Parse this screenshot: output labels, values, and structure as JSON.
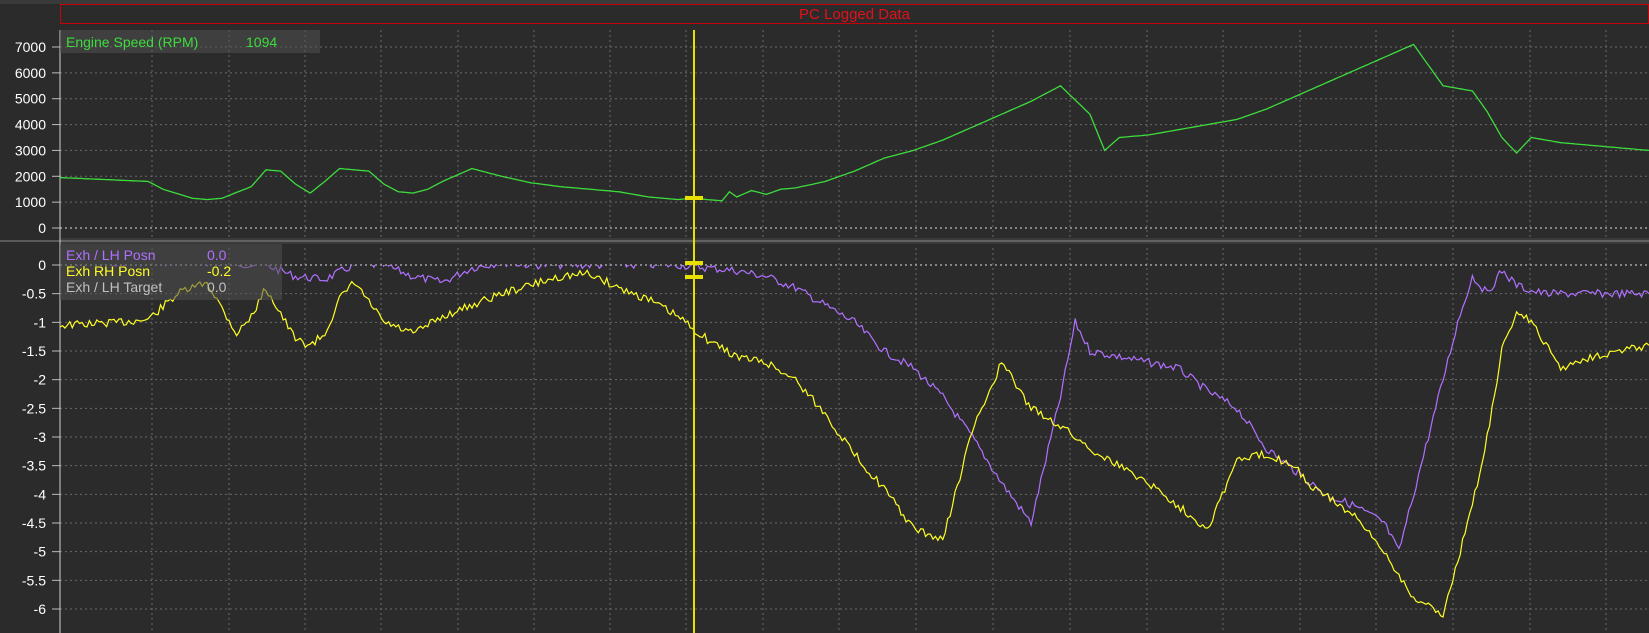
{
  "header": {
    "title": "PC Logged Data"
  },
  "colors": {
    "background": "#2b2b2b",
    "grid": "#6a6a6a",
    "title": "#e3101a",
    "speed": "#3ddc3d",
    "lh_posn": "#b070ff",
    "rh_posn": "#ffff22",
    "lh_target": "#c0c0c0",
    "cursor": "#e8e000"
  },
  "chart_data": [
    {
      "type": "line",
      "title": "",
      "ylim": [
        0,
        7000
      ],
      "y_ticks": [
        "7000",
        "6000",
        "5000",
        "4000",
        "3000",
        "2000",
        "1000",
        "0"
      ],
      "legend": {
        "position": "top-left"
      },
      "grid": true,
      "series": [
        {
          "name": "Engine Speed (RPM)",
          "cursor_value": "1094",
          "x": [
            0,
            2,
            4,
            6,
            7,
            9,
            10,
            11,
            13,
            14,
            15,
            16,
            17,
            18,
            19,
            20,
            21,
            22,
            23,
            24,
            25,
            26,
            28,
            30,
            32,
            34,
            36,
            38,
            39,
            40,
            41,
            42,
            43,
            44,
            45,
            45.5,
            46,
            47,
            48,
            49,
            50,
            52,
            54,
            56,
            58,
            60,
            62,
            64,
            66,
            68,
            70,
            71,
            72,
            73,
            74,
            75,
            76,
            78,
            80,
            82,
            84,
            86,
            88,
            90,
            92,
            94,
            96,
            97,
            98,
            99,
            100,
            101,
            102,
            104,
            106,
            108
          ],
          "values": [
            1950,
            1900,
            1850,
            1800,
            1500,
            1150,
            1100,
            1150,
            1600,
            2250,
            2200,
            1700,
            1350,
            1800,
            2300,
            2250,
            2200,
            1700,
            1400,
            1350,
            1500,
            1800,
            2300,
            2000,
            1750,
            1600,
            1500,
            1400,
            1300,
            1200,
            1150,
            1100,
            1150,
            1100,
            1050,
            1400,
            1200,
            1450,
            1300,
            1500,
            1550,
            1800,
            2200,
            2700,
            3000,
            3400,
            3900,
            4400,
            4900,
            5500,
            4400,
            3000,
            3500,
            3550,
            3600,
            3700,
            3800,
            4000,
            4200,
            4600,
            5100,
            5600,
            6100,
            6600,
            7100,
            5500,
            5300,
            4500,
            3500,
            2900,
            3500,
            3400,
            3300,
            3200,
            3100,
            3000
          ]
        }
      ]
    },
    {
      "type": "line",
      "title": "",
      "ylim": [
        -6.25,
        0
      ],
      "y_ticks": [
        "0",
        "-0.5",
        "-1",
        "-1.5",
        "-2",
        "-2.5",
        "-3",
        "-3.5",
        "-4",
        "-4.5",
        "-5",
        "-5.5",
        "-6"
      ],
      "legend": {
        "position": "top-left"
      },
      "grid": true,
      "series": [
        {
          "name": "Exh / LH Posn",
          "cursor_value": "0.0",
          "x": [
            0,
            10,
            14,
            16,
            18,
            20,
            22,
            24,
            26,
            28,
            30,
            32,
            34,
            36,
            38,
            40,
            42,
            44,
            46,
            48,
            50,
            52,
            54,
            56,
            58,
            60,
            62,
            64,
            66,
            68,
            69,
            70,
            72,
            74,
            76,
            78,
            80,
            82,
            84,
            86,
            88,
            90,
            91,
            92,
            93,
            94,
            95,
            96,
            97,
            98,
            99,
            100,
            101,
            102,
            104,
            106,
            108
          ],
          "values": [
            0.05,
            0.05,
            0.0,
            -0.2,
            -0.25,
            0.0,
            0.0,
            -0.2,
            -0.3,
            -0.05,
            0.05,
            0.0,
            0.0,
            0.0,
            0.0,
            0.0,
            0.0,
            -0.05,
            -0.1,
            -0.2,
            -0.4,
            -0.7,
            -1.0,
            -1.5,
            -1.8,
            -2.3,
            -3.0,
            -3.8,
            -4.5,
            -2.3,
            -1.0,
            -1.5,
            -1.6,
            -1.7,
            -1.8,
            -2.2,
            -2.5,
            -3.2,
            -3.6,
            -4.0,
            -4.2,
            -4.5,
            -5.0,
            -4.0,
            -3.0,
            -2.0,
            -1.0,
            -0.2,
            -0.5,
            -0.1,
            -0.35,
            -0.45,
            -0.5,
            -0.5,
            -0.5,
            -0.5,
            -0.5
          ]
        },
        {
          "name": "Exh RH Posn",
          "cursor_value": "-0.2",
          "x": [
            0,
            4,
            6,
            8,
            10,
            12,
            13,
            14,
            16,
            17,
            18,
            19,
            20,
            22,
            24,
            26,
            28,
            30,
            32,
            34,
            36,
            38,
            40,
            42,
            44,
            46,
            48,
            50,
            52,
            54,
            56,
            58,
            60,
            62,
            64,
            66,
            68,
            69,
            70,
            72,
            74,
            76,
            78,
            80,
            82,
            84,
            85,
            86,
            88,
            90,
            92,
            94,
            96,
            97,
            98,
            99,
            100,
            101,
            102,
            104,
            106,
            108
          ],
          "values": [
            -1.05,
            -1.0,
            -0.95,
            -0.5,
            -0.3,
            -1.2,
            -0.9,
            -0.4,
            -1.3,
            -1.4,
            -1.2,
            -0.6,
            -0.3,
            -1.0,
            -1.2,
            -0.9,
            -0.7,
            -0.5,
            -0.35,
            -0.2,
            -0.15,
            -0.4,
            -0.6,
            -0.9,
            -1.3,
            -1.6,
            -1.7,
            -2.0,
            -2.6,
            -3.3,
            -3.9,
            -4.6,
            -4.8,
            -2.9,
            -1.7,
            -2.5,
            -2.8,
            -3.0,
            -3.2,
            -3.5,
            -3.8,
            -4.2,
            -4.6,
            -3.4,
            -3.3,
            -3.5,
            -3.9,
            -4.0,
            -4.4,
            -5.0,
            -5.8,
            -6.1,
            -4.2,
            -3.0,
            -1.5,
            -0.8,
            -1.0,
            -1.4,
            -1.8,
            -1.6,
            -1.5,
            -1.4
          ]
        },
        {
          "name": "Exh / LH Target",
          "cursor_value": "0.0",
          "x": [],
          "values": []
        }
      ]
    }
  ]
}
